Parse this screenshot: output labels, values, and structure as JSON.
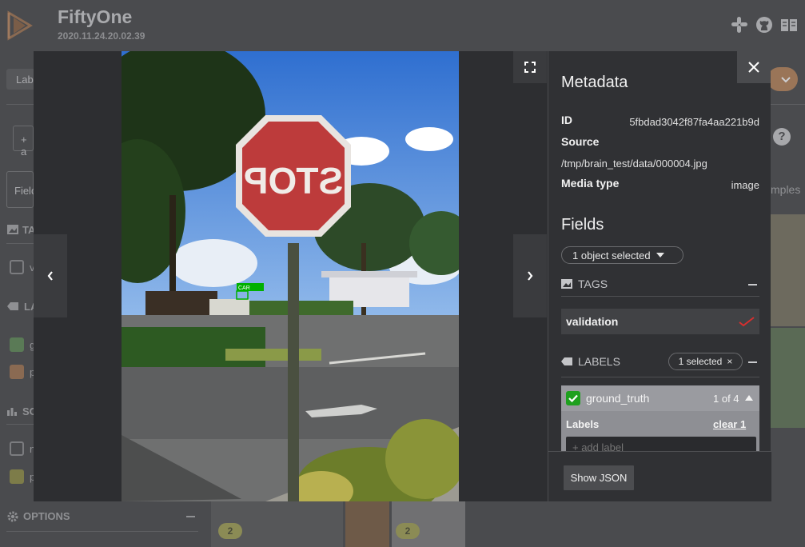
{
  "app": {
    "title": "FiftyOne",
    "dataset_version": "2020.11.24.20.02.39"
  },
  "background": {
    "labels_tab_fragment": "Labe",
    "add_fragment": "+ a",
    "fields_fragment": "Field",
    "tags_fragment": "TA",
    "labels_section_fragment": "LA",
    "scalars_fragment": "SC",
    "row_fragments": [
      "v",
      "g",
      "p",
      "n",
      "p"
    ],
    "samples_fragment": "mples",
    "options_label": "OPTIONS",
    "help_glyph": "?",
    "badges": [
      "2",
      "2"
    ]
  },
  "viewer": {
    "box_label": "CAR",
    "sign_text": "STOP"
  },
  "sidebar": {
    "metadata_heading": "Metadata",
    "id_label": "ID",
    "id_value": "5fbdad3042f87fa4aa221b9d",
    "source_label": "Source",
    "source_value": "/tmp/brain_test/data/000004.jpg",
    "media_type_label": "Media type",
    "media_type_value": "image",
    "fields_heading": "Fields",
    "selection_label": "1 object selected",
    "tags_section": "TAGS",
    "tag_value": "validation",
    "labels_section": "LABELS",
    "labels_selected": "1 selected",
    "labels_selected_close": "×",
    "ground_truth": {
      "name": "ground_truth",
      "count": "1 of 4",
      "labels_label": "Labels",
      "clear_label": "clear 1",
      "add_placeholder": "+ add label"
    },
    "show_json": "Show JSON"
  },
  "colors": {
    "accent_orange": "#c5885a",
    "checkbox_green": "#1ea01e",
    "tag_check_red": "#d62f2f",
    "box_green": "#00b000"
  },
  "icons": [
    "logo-icon",
    "slack-icon",
    "github-icon",
    "book-icon",
    "expand-icon",
    "close-icon",
    "prev-icon",
    "next-icon",
    "image-icon",
    "label-tag-icon",
    "check-icon",
    "chevron-up-icon",
    "caret-down-icon",
    "gear-icon"
  ]
}
